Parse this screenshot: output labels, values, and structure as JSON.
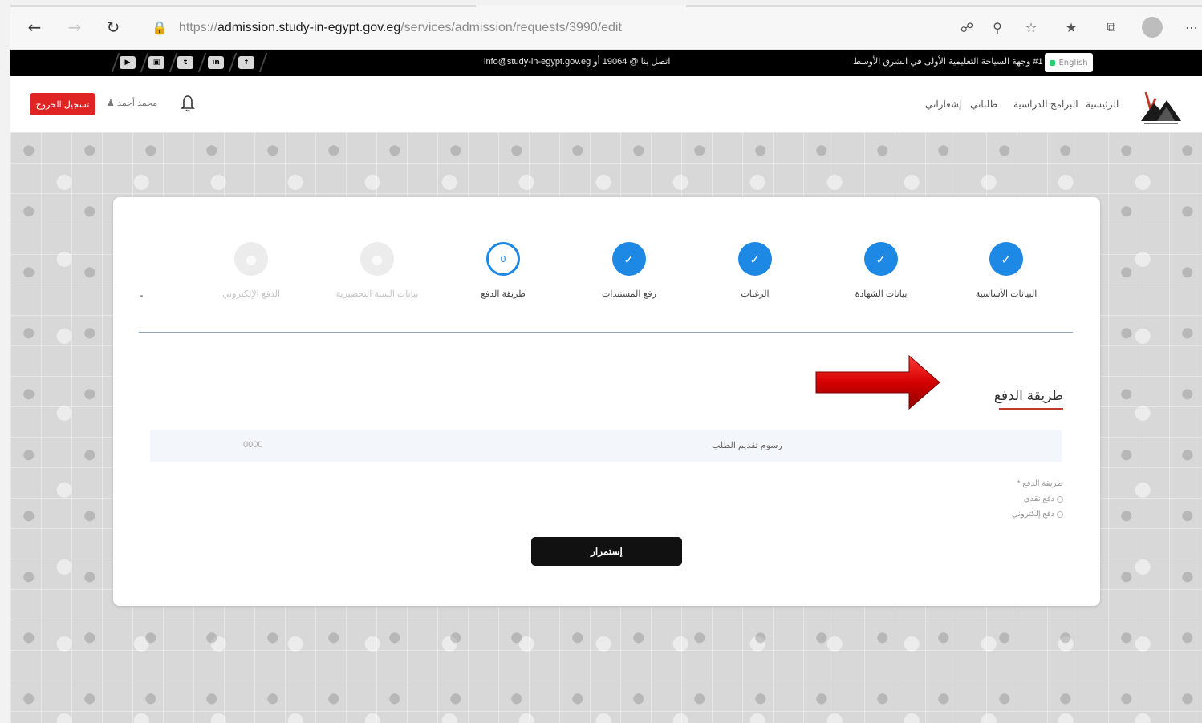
{
  "browser": {
    "url_scheme": "https://",
    "url_host": "admission.study-in-egypt.gov.eg",
    "url_path": "/services/admission/requests/3990/edit"
  },
  "topbar": {
    "contact": "اتصل بنا @ 19064 أو info@study-in-egypt.gov.eg",
    "slogan": "#1 وجهة السياحة التعليمية الأولى في الشرق الأوسط",
    "lang_label": "English",
    "social_icons": [
      "youtube-icon",
      "instagram-icon",
      "twitter-icon",
      "linkedin-icon",
      "facebook-icon"
    ]
  },
  "header": {
    "logout_label": "تسجيل الخروج",
    "user_name": "محمد أحمد",
    "menu": [
      "الرئيسية",
      "البرامج الدراسية",
      "طلباتي",
      "إشعاراتي"
    ]
  },
  "steps": [
    {
      "label": "البيانات الأساسية",
      "state": "done"
    },
    {
      "label": "بيانات الشهادة",
      "state": "done"
    },
    {
      "label": "الرغبات",
      "state": "done"
    },
    {
      "label": "رفع المستندات",
      "state": "done"
    },
    {
      "label": "طريقة الدفع",
      "state": "active",
      "marker": "0"
    },
    {
      "label": "بيانات السنة التحضيرية",
      "state": "pending"
    },
    {
      "label": "الدفع الإلكتروني",
      "state": "pending"
    }
  ],
  "section": {
    "title": "طريقة الدفع",
    "fee_label": "رسوم تقديم الطلب",
    "fee_value": "0000",
    "methods_label": "طريقة الدفع *",
    "methods": [
      "دفع نقدي",
      "دفع إلكتروني"
    ],
    "continue_label": "إستمرار"
  },
  "colors": {
    "accent": "#1e88e5",
    "logout": "#e02424",
    "arrow": "#d40000",
    "button": "#111111"
  }
}
